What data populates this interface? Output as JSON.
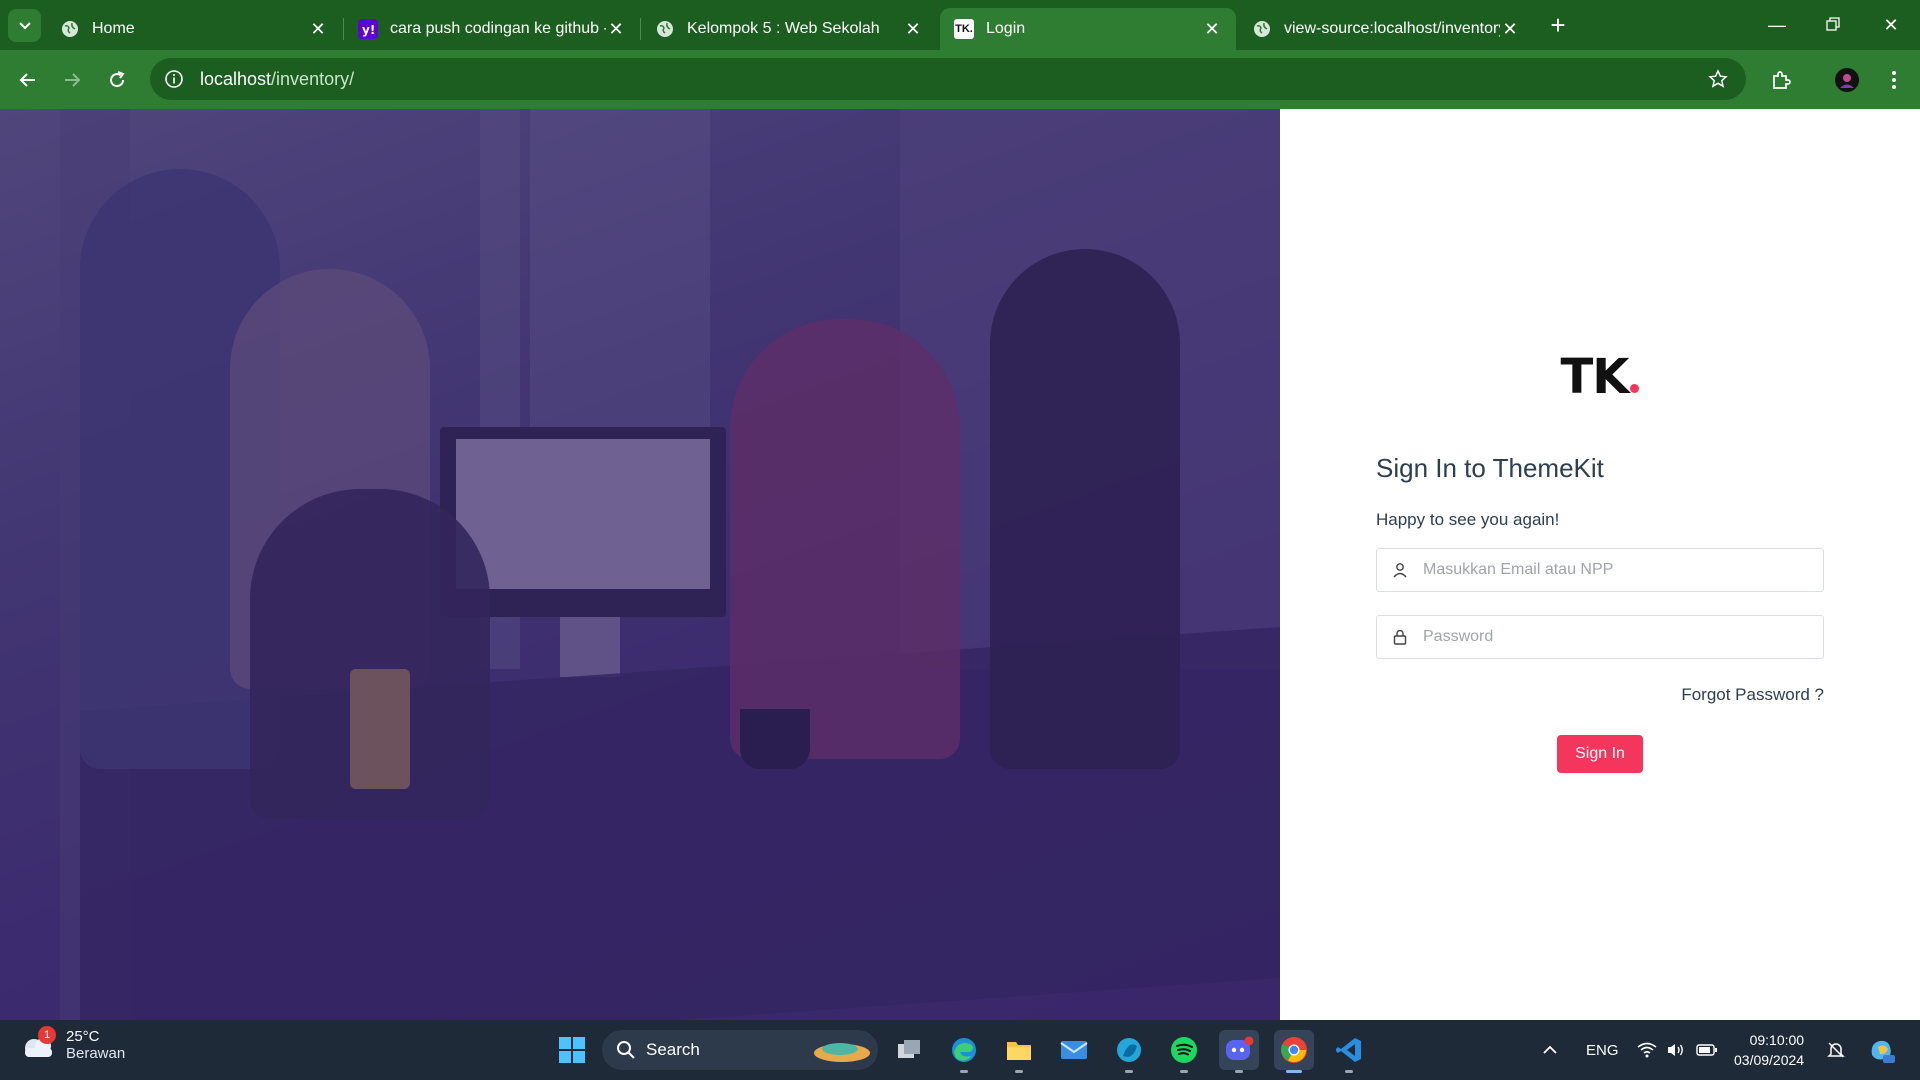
{
  "browser": {
    "tabs": [
      {
        "title": "Home",
        "favicon": "globe-icon"
      },
      {
        "title": "cara push codingan ke github -",
        "favicon": "yahoo-icon"
      },
      {
        "title": "Kelompok 5 : Web Sekolah",
        "favicon": "globe-icon"
      },
      {
        "title": "Login",
        "favicon": "tk-icon",
        "favicon_text": "TK.",
        "active": true
      },
      {
        "title": "view-source:localhost/inventory",
        "favicon": "globe-icon"
      }
    ],
    "address": {
      "host": "localhost",
      "path": "/inventory/"
    },
    "accent": "#2e7d32"
  },
  "login": {
    "logo": "TK",
    "heading": "Sign In to ThemeKit",
    "subheading": "Happy to see you again!",
    "email_placeholder": "Masukkan Email atau NPP",
    "password_placeholder": "Password",
    "forgot_label": "Forgot Password ?",
    "signin_label": "Sign In",
    "button_color": "#f5365c"
  },
  "taskbar": {
    "weather": {
      "temp": "25°C",
      "condition": "Berawan",
      "badge": "1"
    },
    "search_label": "Search",
    "language": "ENG",
    "time": "09:10:00",
    "date": "03/09/2024",
    "apps": [
      "windows-start-icon",
      "task-view-icon",
      "edge-icon",
      "file-explorer-icon",
      "mail-icon",
      "edge-canary-icon",
      "spotify-icon",
      "discord-icon",
      "chrome-icon",
      "vscode-icon"
    ]
  }
}
